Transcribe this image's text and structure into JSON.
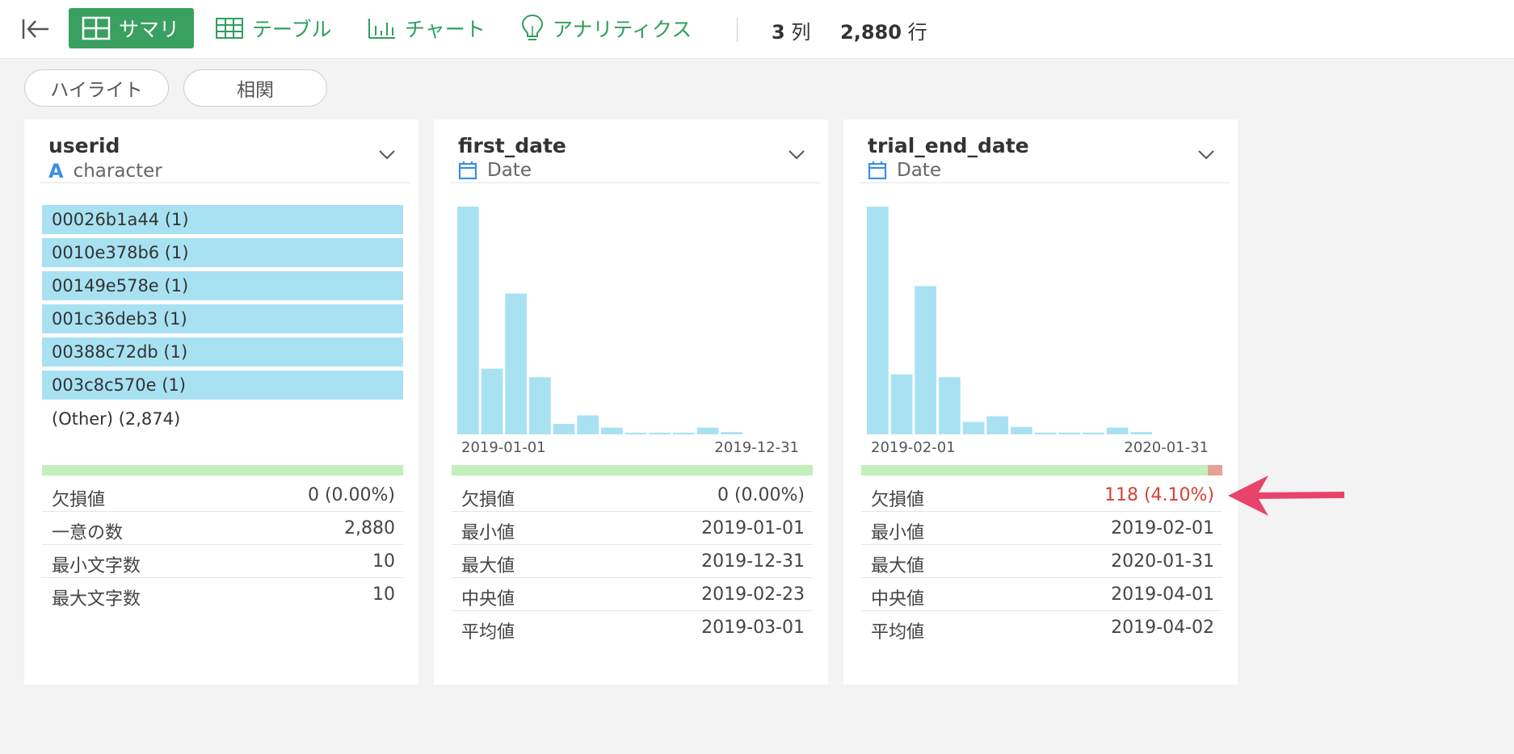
{
  "toolbar": {
    "tabs": [
      {
        "label": "サマリ",
        "icon": "summary-grid-icon",
        "active": true
      },
      {
        "label": "テーブル",
        "icon": "table-icon"
      },
      {
        "label": "チャート",
        "icon": "bar-chart-icon"
      },
      {
        "label": "アナリティクス",
        "icon": "lightbulb-icon"
      }
    ],
    "cols_num": "3",
    "cols_unit": "列",
    "rows_num": "2,880",
    "rows_unit": "行"
  },
  "filters": {
    "highlight": "ハイライト",
    "correlation": "相関"
  },
  "colors": {
    "accent": "#3aa05f",
    "bar": "#a8e2f2",
    "quality_ok": "#c3efbb",
    "quality_missing": "#e6a196",
    "missing_text": "#d64235",
    "arrow": "#e8436b"
  },
  "columns": [
    {
      "name": "userid",
      "type": "character",
      "type_icon": "character-a-icon",
      "top_values": [
        "00026b1a44 (1)",
        "0010e378b6 (1)",
        "00149e578e (1)",
        "001c36deb3 (1)",
        "00388c72db (1)",
        "003c8c570e (1)"
      ],
      "other": "(Other) (2,874)",
      "missing_fraction": 0.0,
      "stats": [
        {
          "label": "欠損値",
          "value": "0 (0.00%)"
        },
        {
          "label": "一意の数",
          "value": "2,880"
        },
        {
          "label": "最小文字数",
          "value": "10"
        },
        {
          "label": "最大文字数",
          "value": "10"
        }
      ]
    },
    {
      "name": "first_date",
      "type": "Date",
      "type_icon": "calendar-icon",
      "histogram": {
        "counts": [
          805,
          232,
          498,
          202,
          37,
          67,
          24,
          5,
          5,
          5,
          24,
          8
        ],
        "x_start": "2019-01-01",
        "x_end": "2019-12-31"
      },
      "missing_fraction": 0.0,
      "stats": [
        {
          "label": "欠損値",
          "value": "0 (0.00%)"
        },
        {
          "label": "最小値",
          "value": "2019-01-01"
        },
        {
          "label": "最大値",
          "value": "2019-12-31"
        },
        {
          "label": "中央値",
          "value": "2019-02-23"
        },
        {
          "label": "平均値",
          "value": "2019-03-01"
        }
      ]
    },
    {
      "name": "trial_end_date",
      "type": "Date",
      "type_icon": "calendar-icon",
      "histogram": {
        "counts": [
          805,
          212,
          524,
          202,
          44,
          64,
          26,
          6,
          6,
          6,
          24,
          8
        ],
        "x_start": "2019-02-01",
        "x_end": "2020-01-31"
      },
      "missing_fraction": 0.041,
      "stats": [
        {
          "label": "欠損値",
          "value": "118 (4.10%)",
          "highlight": true
        },
        {
          "label": "最小値",
          "value": "2019-02-01"
        },
        {
          "label": "最大値",
          "value": "2020-01-31"
        },
        {
          "label": "中央値",
          "value": "2019-04-01"
        },
        {
          "label": "平均値",
          "value": "2019-04-02"
        }
      ]
    }
  ]
}
